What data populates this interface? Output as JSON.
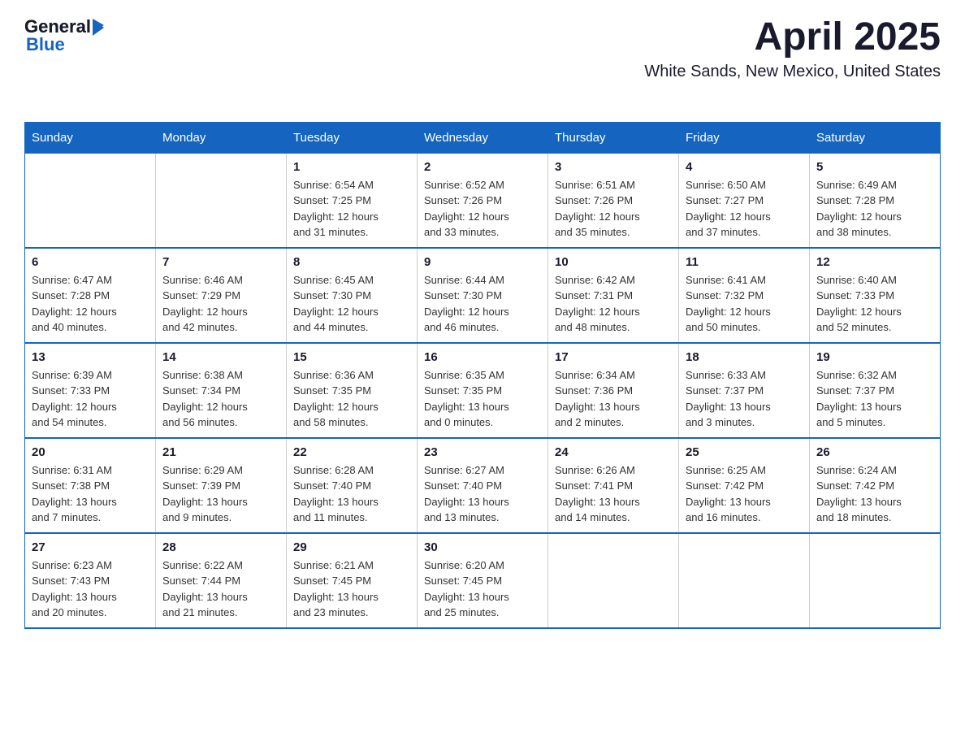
{
  "header": {
    "logo_text_general": "General",
    "logo_text_blue": "Blue",
    "month_title": "April 2025",
    "location": "White Sands, New Mexico, United States"
  },
  "calendar": {
    "days_of_week": [
      "Sunday",
      "Monday",
      "Tuesday",
      "Wednesday",
      "Thursday",
      "Friday",
      "Saturday"
    ],
    "weeks": [
      [
        {
          "day": "",
          "info": ""
        },
        {
          "day": "",
          "info": ""
        },
        {
          "day": "1",
          "info": "Sunrise: 6:54 AM\nSunset: 7:25 PM\nDaylight: 12 hours\nand 31 minutes."
        },
        {
          "day": "2",
          "info": "Sunrise: 6:52 AM\nSunset: 7:26 PM\nDaylight: 12 hours\nand 33 minutes."
        },
        {
          "day": "3",
          "info": "Sunrise: 6:51 AM\nSunset: 7:26 PM\nDaylight: 12 hours\nand 35 minutes."
        },
        {
          "day": "4",
          "info": "Sunrise: 6:50 AM\nSunset: 7:27 PM\nDaylight: 12 hours\nand 37 minutes."
        },
        {
          "day": "5",
          "info": "Sunrise: 6:49 AM\nSunset: 7:28 PM\nDaylight: 12 hours\nand 38 minutes."
        }
      ],
      [
        {
          "day": "6",
          "info": "Sunrise: 6:47 AM\nSunset: 7:28 PM\nDaylight: 12 hours\nand 40 minutes."
        },
        {
          "day": "7",
          "info": "Sunrise: 6:46 AM\nSunset: 7:29 PM\nDaylight: 12 hours\nand 42 minutes."
        },
        {
          "day": "8",
          "info": "Sunrise: 6:45 AM\nSunset: 7:30 PM\nDaylight: 12 hours\nand 44 minutes."
        },
        {
          "day": "9",
          "info": "Sunrise: 6:44 AM\nSunset: 7:30 PM\nDaylight: 12 hours\nand 46 minutes."
        },
        {
          "day": "10",
          "info": "Sunrise: 6:42 AM\nSunset: 7:31 PM\nDaylight: 12 hours\nand 48 minutes."
        },
        {
          "day": "11",
          "info": "Sunrise: 6:41 AM\nSunset: 7:32 PM\nDaylight: 12 hours\nand 50 minutes."
        },
        {
          "day": "12",
          "info": "Sunrise: 6:40 AM\nSunset: 7:33 PM\nDaylight: 12 hours\nand 52 minutes."
        }
      ],
      [
        {
          "day": "13",
          "info": "Sunrise: 6:39 AM\nSunset: 7:33 PM\nDaylight: 12 hours\nand 54 minutes."
        },
        {
          "day": "14",
          "info": "Sunrise: 6:38 AM\nSunset: 7:34 PM\nDaylight: 12 hours\nand 56 minutes."
        },
        {
          "day": "15",
          "info": "Sunrise: 6:36 AM\nSunset: 7:35 PM\nDaylight: 12 hours\nand 58 minutes."
        },
        {
          "day": "16",
          "info": "Sunrise: 6:35 AM\nSunset: 7:35 PM\nDaylight: 13 hours\nand 0 minutes."
        },
        {
          "day": "17",
          "info": "Sunrise: 6:34 AM\nSunset: 7:36 PM\nDaylight: 13 hours\nand 2 minutes."
        },
        {
          "day": "18",
          "info": "Sunrise: 6:33 AM\nSunset: 7:37 PM\nDaylight: 13 hours\nand 3 minutes."
        },
        {
          "day": "19",
          "info": "Sunrise: 6:32 AM\nSunset: 7:37 PM\nDaylight: 13 hours\nand 5 minutes."
        }
      ],
      [
        {
          "day": "20",
          "info": "Sunrise: 6:31 AM\nSunset: 7:38 PM\nDaylight: 13 hours\nand 7 minutes."
        },
        {
          "day": "21",
          "info": "Sunrise: 6:29 AM\nSunset: 7:39 PM\nDaylight: 13 hours\nand 9 minutes."
        },
        {
          "day": "22",
          "info": "Sunrise: 6:28 AM\nSunset: 7:40 PM\nDaylight: 13 hours\nand 11 minutes."
        },
        {
          "day": "23",
          "info": "Sunrise: 6:27 AM\nSunset: 7:40 PM\nDaylight: 13 hours\nand 13 minutes."
        },
        {
          "day": "24",
          "info": "Sunrise: 6:26 AM\nSunset: 7:41 PM\nDaylight: 13 hours\nand 14 minutes."
        },
        {
          "day": "25",
          "info": "Sunrise: 6:25 AM\nSunset: 7:42 PM\nDaylight: 13 hours\nand 16 minutes."
        },
        {
          "day": "26",
          "info": "Sunrise: 6:24 AM\nSunset: 7:42 PM\nDaylight: 13 hours\nand 18 minutes."
        }
      ],
      [
        {
          "day": "27",
          "info": "Sunrise: 6:23 AM\nSunset: 7:43 PM\nDaylight: 13 hours\nand 20 minutes."
        },
        {
          "day": "28",
          "info": "Sunrise: 6:22 AM\nSunset: 7:44 PM\nDaylight: 13 hours\nand 21 minutes."
        },
        {
          "day": "29",
          "info": "Sunrise: 6:21 AM\nSunset: 7:45 PM\nDaylight: 13 hours\nand 23 minutes."
        },
        {
          "day": "30",
          "info": "Sunrise: 6:20 AM\nSunset: 7:45 PM\nDaylight: 13 hours\nand 25 minutes."
        },
        {
          "day": "",
          "info": ""
        },
        {
          "day": "",
          "info": ""
        },
        {
          "day": "",
          "info": ""
        }
      ]
    ]
  }
}
